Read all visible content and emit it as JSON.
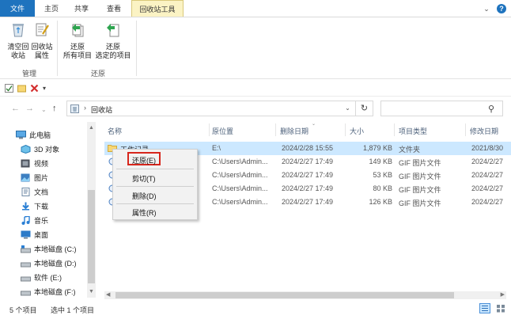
{
  "ribbon_tabs": {
    "file": "文件",
    "home": "主页",
    "share": "共享",
    "view": "查看",
    "manage": "回收站工具"
  },
  "ribbon": {
    "empty_bin": [
      "清空回",
      "收站"
    ],
    "properties": [
      "回收站",
      "属性"
    ],
    "restore_all": [
      "还原",
      "所有项目"
    ],
    "restore_selected": [
      "还原",
      "选定的项目"
    ],
    "group_manage": "管理",
    "group_restore": "还原"
  },
  "address": {
    "breadcrumb": "回收站",
    "search_placeholder": ""
  },
  "sidebar": {
    "items": [
      {
        "label": "此电脑",
        "icon": "computer-icon"
      },
      {
        "label": "3D 对象",
        "icon": "3d-objects-icon"
      },
      {
        "label": "视频",
        "icon": "video-icon"
      },
      {
        "label": "图片",
        "icon": "pictures-icon"
      },
      {
        "label": "文档",
        "icon": "documents-icon"
      },
      {
        "label": "下载",
        "icon": "download-icon"
      },
      {
        "label": "音乐",
        "icon": "music-icon"
      },
      {
        "label": "桌面",
        "icon": "desktop-icon"
      },
      {
        "label": "本地磁盘 (C:)",
        "icon": "drive-c-icon"
      },
      {
        "label": "本地磁盘 (D:)",
        "icon": "drive-icon"
      },
      {
        "label": "软件 (E:)",
        "icon": "drive-icon"
      },
      {
        "label": "本地磁盘 (F:)",
        "icon": "drive-icon"
      }
    ]
  },
  "list": {
    "columns": {
      "name": "名称",
      "location": "原位置",
      "deleted": "删除日期",
      "size": "大小",
      "type": "项目类型",
      "modified": "修改日期"
    },
    "rows": [
      {
        "name": "工作记录",
        "location": "E:\\",
        "deleted": "2024/2/28 15:55",
        "size": "1,879 KB",
        "type": "文件夹",
        "modified": "2021/8/30",
        "kind": "folder"
      },
      {
        "name": "",
        "location": "C:\\Users\\Admin...",
        "deleted": "2024/2/27 17:49",
        "size": "149 KB",
        "type": "GIF 图片文件",
        "modified": "2024/2/27",
        "kind": "gif"
      },
      {
        "name": "",
        "location": "C:\\Users\\Admin...",
        "deleted": "2024/2/27 17:49",
        "size": "53 KB",
        "type": "GIF 图片文件",
        "modified": "2024/2/27",
        "kind": "gif"
      },
      {
        "name": "",
        "location": "C:\\Users\\Admin...",
        "deleted": "2024/2/27 17:49",
        "size": "80 KB",
        "type": "GIF 图片文件",
        "modified": "2024/2/27",
        "kind": "gif"
      },
      {
        "name": "",
        "location": "C:\\Users\\Admin...",
        "deleted": "2024/2/27 17:49",
        "size": "126 KB",
        "type": "GIF 图片文件",
        "modified": "2024/2/27",
        "kind": "gif"
      }
    ]
  },
  "context_menu": {
    "restore": "还原(E)",
    "cut": "剪切(T)",
    "delete": "删除(D)",
    "properties": "属性(R)",
    "highlight_color": "#d7261c"
  },
  "status": {
    "count": "5 个项目",
    "selected": "选中 1 个项目"
  },
  "colors": {
    "file_tab": "#1e73be",
    "context_tab": "#fbf3c4",
    "selection": "#cce8ff"
  }
}
